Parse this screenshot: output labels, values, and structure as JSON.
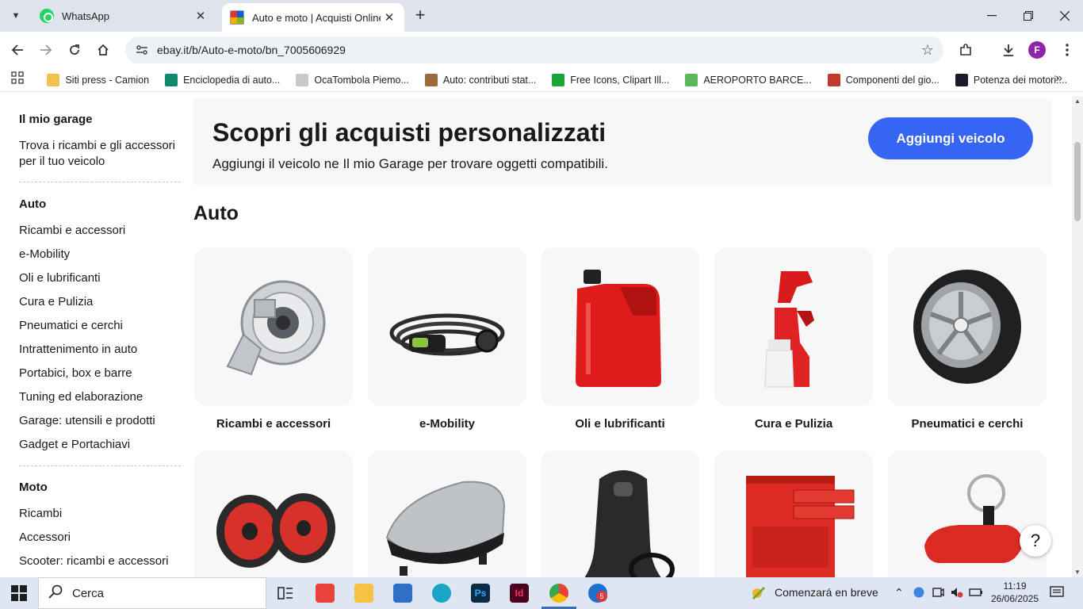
{
  "browser": {
    "tabs": [
      {
        "title": "WhatsApp",
        "active": false
      },
      {
        "title": "Auto e moto | Acquisti Online s",
        "active": true
      }
    ],
    "url": "ebay.it/b/Auto-e-moto/bn_7005606929",
    "profile_initial": "F",
    "bookmarks": [
      {
        "label": "Siti press - Camion",
        "color": "#f2c14e"
      },
      {
        "label": "Enciclopedia di auto...",
        "color": "#0f8a6b"
      },
      {
        "label": "OcaTombola Piemo...",
        "color": "#c9c9c9"
      },
      {
        "label": "Auto: contributi stat...",
        "color": "#9b6b3c"
      },
      {
        "label": "Free Icons, Clipart Ill...",
        "color": "#19a43a"
      },
      {
        "label": "AEROPORTO BARCE...",
        "color": "#5cb85c"
      },
      {
        "label": "Componenti del gio...",
        "color": "#c0392b"
      },
      {
        "label": "Potenza dei motori:...",
        "color": "#1a1a2e"
      }
    ]
  },
  "sidebar": {
    "garage": {
      "heading": "Il mio garage",
      "text": "Trova i ricambi e gli accessori per il tuo veicolo"
    },
    "auto": {
      "heading": "Auto",
      "links": [
        "Ricambi e accessori",
        "e-Mobility",
        "Oli e lubrificanti",
        "Cura e Pulizia",
        "Pneumatici e cerchi",
        "Intrattenimento in auto",
        "Portabici, box e barre",
        "Tuning ed elaborazione",
        "Garage: utensili e prodotti",
        "Gadget e Portachiavi"
      ]
    },
    "moto": {
      "heading": "Moto",
      "links": [
        "Ricambi",
        "Accessori",
        "Scooter: ricambi e accessori"
      ]
    }
  },
  "banner": {
    "title": "Scopri gli acquisti personalizzati",
    "subtitle": "Aggiungi il veicolo ne Il mio Garage per trovare oggetti compatibili.",
    "button": "Aggiungi veicolo"
  },
  "section_title": "Auto",
  "tiles_row1": [
    {
      "label": "Ricambi e accessori",
      "icon": "turbo-icon"
    },
    {
      "label": "e-Mobility",
      "icon": "ev-charger-icon"
    },
    {
      "label": "Oli e lubrificanti",
      "icon": "oil-can-icon"
    },
    {
      "label": "Cura e Pulizia",
      "icon": "spray-bottle-icon"
    },
    {
      "label": "Pneumatici e cerchi",
      "icon": "wheel-icon"
    }
  ],
  "tiles_row2": [
    {
      "icon": "speakers-icon"
    },
    {
      "icon": "roof-box-icon"
    },
    {
      "icon": "racing-seat-icon"
    },
    {
      "icon": "tool-cabinet-icon"
    },
    {
      "icon": "car-keychain-icon"
    }
  ],
  "help": "?",
  "taskbar": {
    "search_placeholder": "Cerca",
    "status_text": "Comenzará en breve",
    "time": "11:19",
    "date": "26/06/2025",
    "badge": "5"
  },
  "colors": {
    "ebay_blue": "#3665f3",
    "tile_bg": "#f7f7f7"
  }
}
